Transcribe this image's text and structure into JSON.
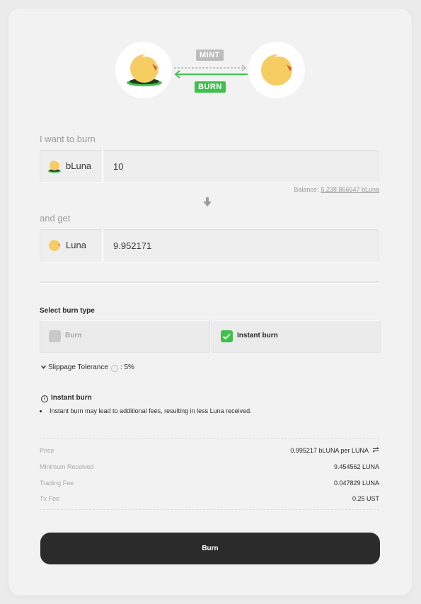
{
  "header": {
    "mint_tag": "MINT",
    "burn_tag": "BURN",
    "left_token_icon": "bluna-coin-icon",
    "right_token_icon": "luna-coin-icon"
  },
  "burn_input": {
    "label": "I want to burn",
    "token": "bLuna",
    "value": "10",
    "balance_label": "Balance:",
    "balance_value": "5,238.866647 bLuna"
  },
  "get_input": {
    "label": "and get",
    "token": "Luna",
    "value": "9.952171"
  },
  "burn_type": {
    "title": "Select burn type",
    "options": [
      {
        "label": "Burn",
        "selected": false
      },
      {
        "label": "Instant burn",
        "selected": true
      }
    ]
  },
  "slippage": {
    "label": "Slippage Tolerance",
    "value": ": 5%"
  },
  "notice": {
    "title": "Instant burn",
    "items": [
      "Instant burn may lead to additional fees, resulting in less Luna received."
    ]
  },
  "summary": [
    {
      "label": "Price",
      "value": "0.995217 bLUNA per LUNA"
    },
    {
      "label": "Minimum Received",
      "value": "9.454562 LUNA"
    },
    {
      "label": "Trading Fee",
      "value": "0.047829 LUNA"
    },
    {
      "label": "Tx Fee",
      "value": "0.25 UST"
    }
  ],
  "action": {
    "button_label": "Burn"
  },
  "colors": {
    "accent_green": "#3ec14b",
    "button_dark": "#2b2b2b",
    "coin_yellow": "#f6cd63",
    "coin_red": "#e2553a"
  }
}
